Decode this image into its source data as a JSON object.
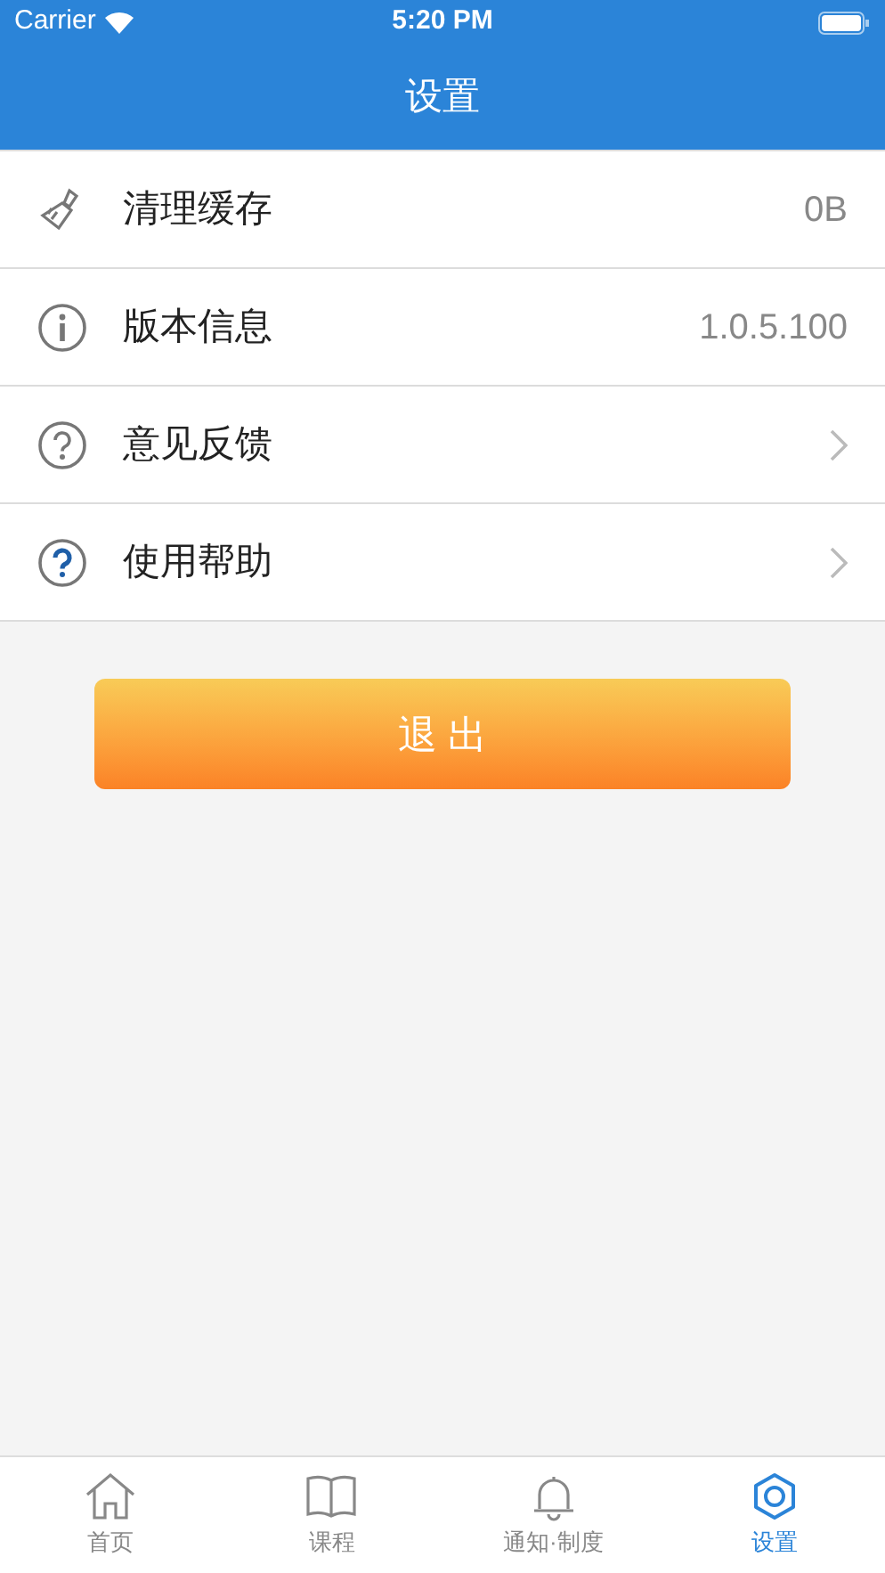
{
  "status_bar": {
    "carrier": "Carrier",
    "time": "5:20 PM"
  },
  "nav": {
    "title": "设置"
  },
  "rows": [
    {
      "label": "清理缓存",
      "kind": "value",
      "value": "0B"
    },
    {
      "label": "版本信息",
      "kind": "value",
      "value": "1.0.5.100"
    },
    {
      "label": "意见反馈",
      "kind": "link"
    },
    {
      "label": "使用帮助",
      "kind": "link"
    }
  ],
  "logout_button": "退 出",
  "tabs": [
    {
      "label": "首页",
      "selected": false
    },
    {
      "label": "课程",
      "selected": false
    },
    {
      "label": "通知·制度",
      "selected": false
    },
    {
      "label": "设置",
      "selected": true
    }
  ]
}
